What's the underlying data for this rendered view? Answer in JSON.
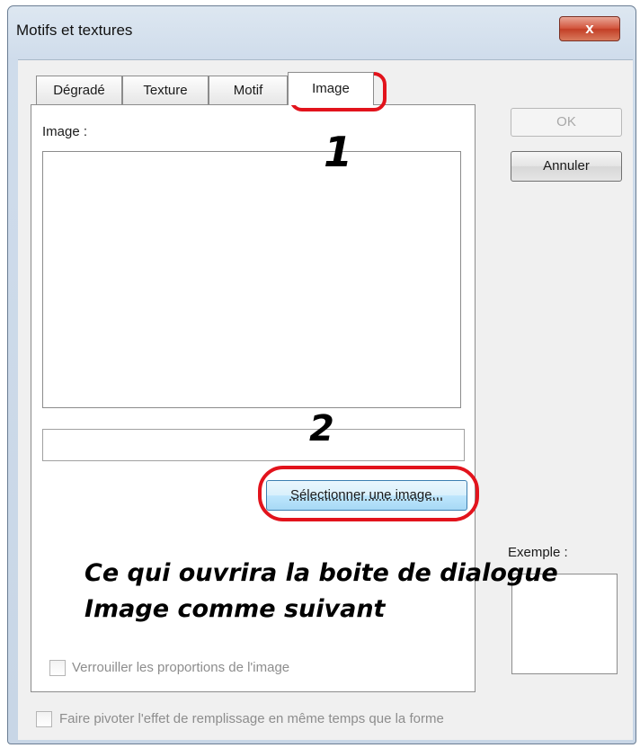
{
  "window": {
    "title": "Motifs et textures",
    "close_glyph": "x"
  },
  "tabs": [
    {
      "label": "Dégradé"
    },
    {
      "label": "Texture"
    },
    {
      "label": "Motif"
    },
    {
      "label": "Image"
    }
  ],
  "active_tab": "Image",
  "panel": {
    "image_label": "Image :",
    "file_field_value": "",
    "select_button": "Sélectionner une image...",
    "lock_checkbox_label": "Verrouiller les proportions de l'image",
    "lock_checked": false
  },
  "buttons": {
    "ok": "OK",
    "cancel": "Annuler"
  },
  "example_label": "Exemple :",
  "rotate_checkbox_label": "Faire pivoter l'effet de remplissage en même temps que la forme",
  "rotate_checked": false,
  "annotations": {
    "marker_1": "1",
    "marker_2": "2",
    "caption_line1": "Ce qui ouvrira la boite de dialogue",
    "caption_line2": "Image comme suivant",
    "highlight_color": "#e2131c"
  }
}
